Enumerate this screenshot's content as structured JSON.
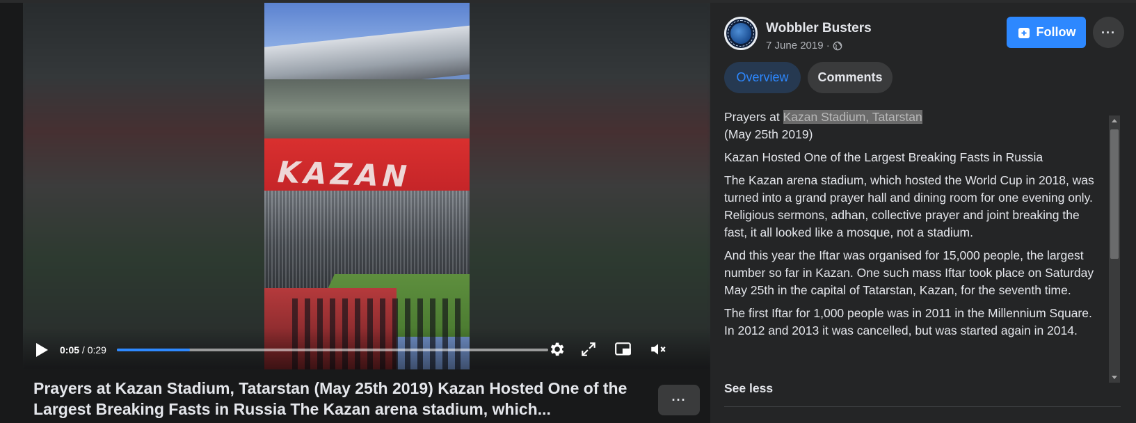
{
  "video": {
    "current_time": "0:05",
    "separator": " / ",
    "duration": "0:29",
    "progress_fraction": 0.17,
    "scene_text": "KAZAN"
  },
  "post": {
    "title": "Prayers at Kazan Stadium, Tatarstan (May 25th 2019) Kazan Hosted One of the Largest Breaking Fasts in Russia The Kazan arena stadium, which...",
    "more_label": "···"
  },
  "page": {
    "name": "Wobbler Busters",
    "date": "7 June 2019 ·",
    "follow_label": "Follow",
    "menu_label": "···"
  },
  "tabs": {
    "overview": "Overview",
    "comments": "Comments"
  },
  "description": {
    "line1_prefix": "Prayers at ",
    "line1_link": "Kazan Stadium, Tatarstan",
    "line2": "(May 25th 2019)",
    "p2": "Kazan Hosted One of the Largest Breaking Fasts in Russia",
    "p3": "The Kazan arena stadium, which hosted the World Cup in 2018, was turned into a grand prayer hall and dining room for one evening only. Religious sermons, adhan, collective prayer and joint breaking the fast, it all looked like a mosque, not a stadium.",
    "p4": "And this year the Iftar was organised for 15,000 people, the largest number so far in Kazan. One such mass Iftar took place on Saturday May 25th in the capital of Tatarstan, Kazan, for the seventh time.",
    "p5a": "The first Iftar for 1,000 people was in 2011 in the Millennium Square.",
    "p5b": "In 2012 and 2013 it was cancelled, but was started again in 2014.",
    "see_less": "See less"
  },
  "colors": {
    "accent": "#2d88ff",
    "panel_bg": "#242526",
    "page_bg": "#18191a"
  }
}
